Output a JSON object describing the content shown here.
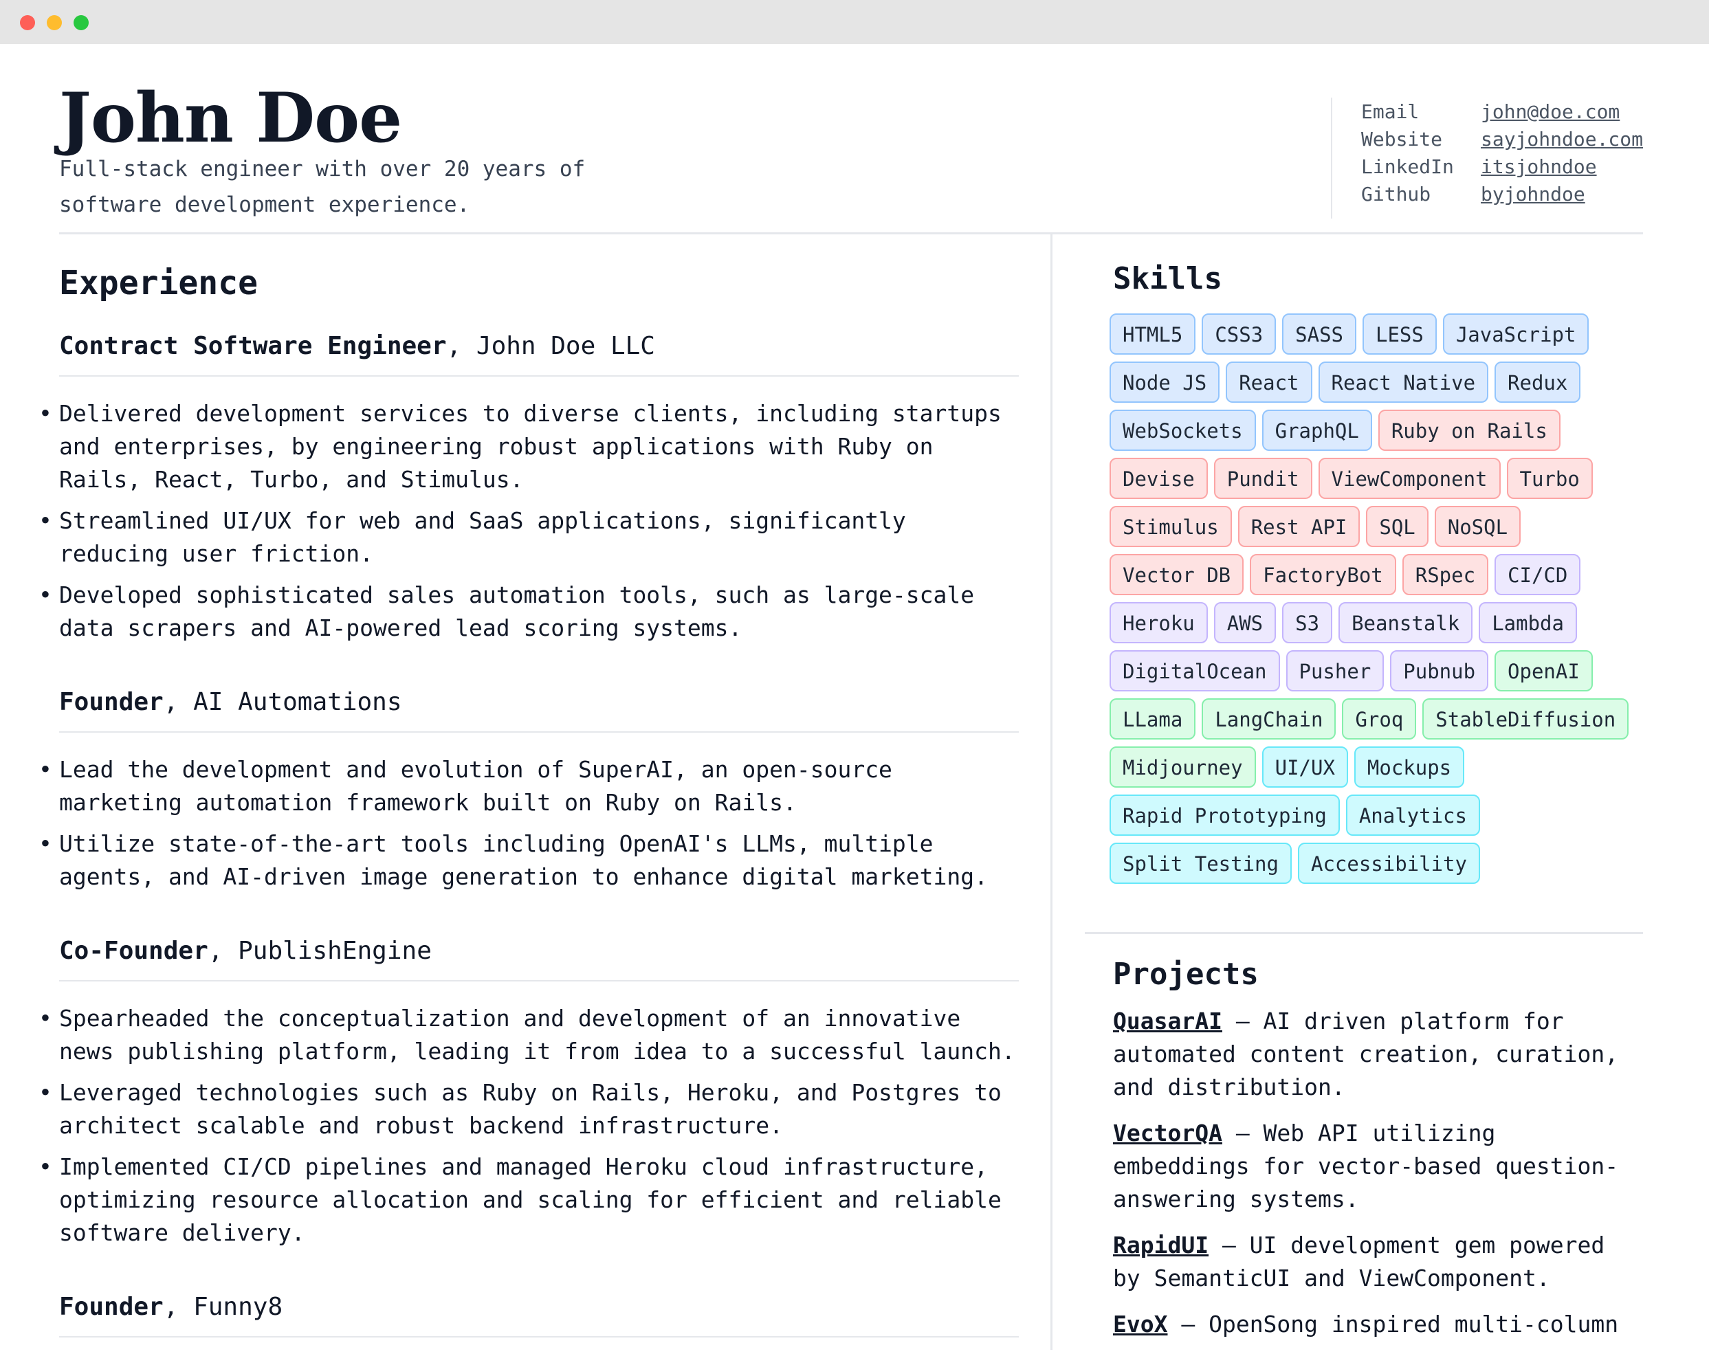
{
  "header": {
    "name": "John Doe",
    "tagline": "Full-stack engineer with over 20 years of software development experience."
  },
  "contact": [
    {
      "label": "Email",
      "value": "john@doe.com"
    },
    {
      "label": "Website",
      "value": "sayjohndoe.com"
    },
    {
      "label": "LinkedIn",
      "value": "itsjohndoe"
    },
    {
      "label": "Github",
      "value": "byjohndoe"
    }
  ],
  "experience": {
    "title": "Experience",
    "jobs": [
      {
        "role": "Contract Software Engineer",
        "company": "John Doe LLC",
        "bullets": [
          "Delivered development services to diverse clients, including startups and enterprises, by engineering robust applications with Ruby on Rails, React, Turbo, and Stimulus.",
          "Streamlined UI/UX for web and SaaS applications, significantly reducing user friction.",
          "Developed sophisticated sales automation tools, such as large-scale data scrapers and AI-powered lead scoring systems."
        ]
      },
      {
        "role": "Founder",
        "company": "AI Automations",
        "bullets": [
          "Lead the development and evolution of SuperAI, an open-source marketing automation framework built on Ruby on Rails.",
          "Utilize state-of-the-art tools including OpenAI's LLMs, multiple agents, and AI-driven image generation to enhance digital marketing."
        ]
      },
      {
        "role": "Co-Founder",
        "company": "PublishEngine",
        "bullets": [
          "Spearheaded the conceptualization and development of an innovative news publishing platform, leading it from idea to a successful launch.",
          "Leveraged technologies such as Ruby on Rails, Heroku, and Postgres to architect scalable and robust backend infrastructure.",
          "Implemented CI/CD pipelines and managed Heroku cloud infrastructure, optimizing resource allocation and scaling for efficient and reliable software delivery."
        ]
      },
      {
        "role": "Founder",
        "company": "Funny8",
        "bullets": []
      }
    ]
  },
  "skills": {
    "title": "Skills",
    "tags": [
      {
        "label": "HTML5",
        "color": "blue"
      },
      {
        "label": "CSS3",
        "color": "blue"
      },
      {
        "label": "SASS",
        "color": "blue"
      },
      {
        "label": "LESS",
        "color": "blue"
      },
      {
        "label": "JavaScript",
        "color": "blue"
      },
      {
        "label": "Node JS",
        "color": "blue"
      },
      {
        "label": "React",
        "color": "blue"
      },
      {
        "label": "React Native",
        "color": "blue"
      },
      {
        "label": "Redux",
        "color": "blue"
      },
      {
        "label": "WebSockets",
        "color": "blue"
      },
      {
        "label": "GraphQL",
        "color": "blue"
      },
      {
        "label": "Ruby on Rails",
        "color": "red"
      },
      {
        "label": "Devise",
        "color": "red"
      },
      {
        "label": "Pundit",
        "color": "red"
      },
      {
        "label": "ViewComponent",
        "color": "red"
      },
      {
        "label": "Turbo",
        "color": "red"
      },
      {
        "label": "Stimulus",
        "color": "red"
      },
      {
        "label": "Rest API",
        "color": "red"
      },
      {
        "label": "SQL",
        "color": "red"
      },
      {
        "label": "NoSQL",
        "color": "red"
      },
      {
        "label": "Vector DB",
        "color": "red"
      },
      {
        "label": "FactoryBot",
        "color": "red"
      },
      {
        "label": "RSpec",
        "color": "red"
      },
      {
        "label": "CI/CD",
        "color": "purple"
      },
      {
        "label": "Heroku",
        "color": "purple"
      },
      {
        "label": "AWS",
        "color": "purple"
      },
      {
        "label": "S3",
        "color": "purple"
      },
      {
        "label": "Beanstalk",
        "color": "purple"
      },
      {
        "label": "Lambda",
        "color": "purple"
      },
      {
        "label": "DigitalOcean",
        "color": "purple"
      },
      {
        "label": "Pusher",
        "color": "purple"
      },
      {
        "label": "Pubnub",
        "color": "purple"
      },
      {
        "label": "OpenAI",
        "color": "green"
      },
      {
        "label": "LLama",
        "color": "green"
      },
      {
        "label": "LangChain",
        "color": "green"
      },
      {
        "label": "Groq",
        "color": "green"
      },
      {
        "label": "StableDiffusion",
        "color": "green"
      },
      {
        "label": "Midjourney",
        "color": "green"
      },
      {
        "label": "UI/UX",
        "color": "cyan"
      },
      {
        "label": "Mockups",
        "color": "cyan"
      },
      {
        "label": "Rapid Prototyping",
        "color": "cyan"
      },
      {
        "label": "Analytics",
        "color": "cyan"
      },
      {
        "label": "Split Testing",
        "color": "cyan"
      },
      {
        "label": "Accessibility",
        "color": "cyan"
      }
    ]
  },
  "projects": {
    "title": "Projects",
    "items": [
      {
        "name": "QuasarAI",
        "description": " – AI driven platform for automated content creation, curation, and distribution."
      },
      {
        "name": "VectorQA",
        "description": " – Web API utilizing embeddings for vector-based question-answering systems."
      },
      {
        "name": "RapidUI",
        "description": " – UI development gem powered by SemanticUI and ViewComponent."
      },
      {
        "name": "EvoX",
        "description": " – OpenSong inspired multi-column"
      }
    ]
  }
}
